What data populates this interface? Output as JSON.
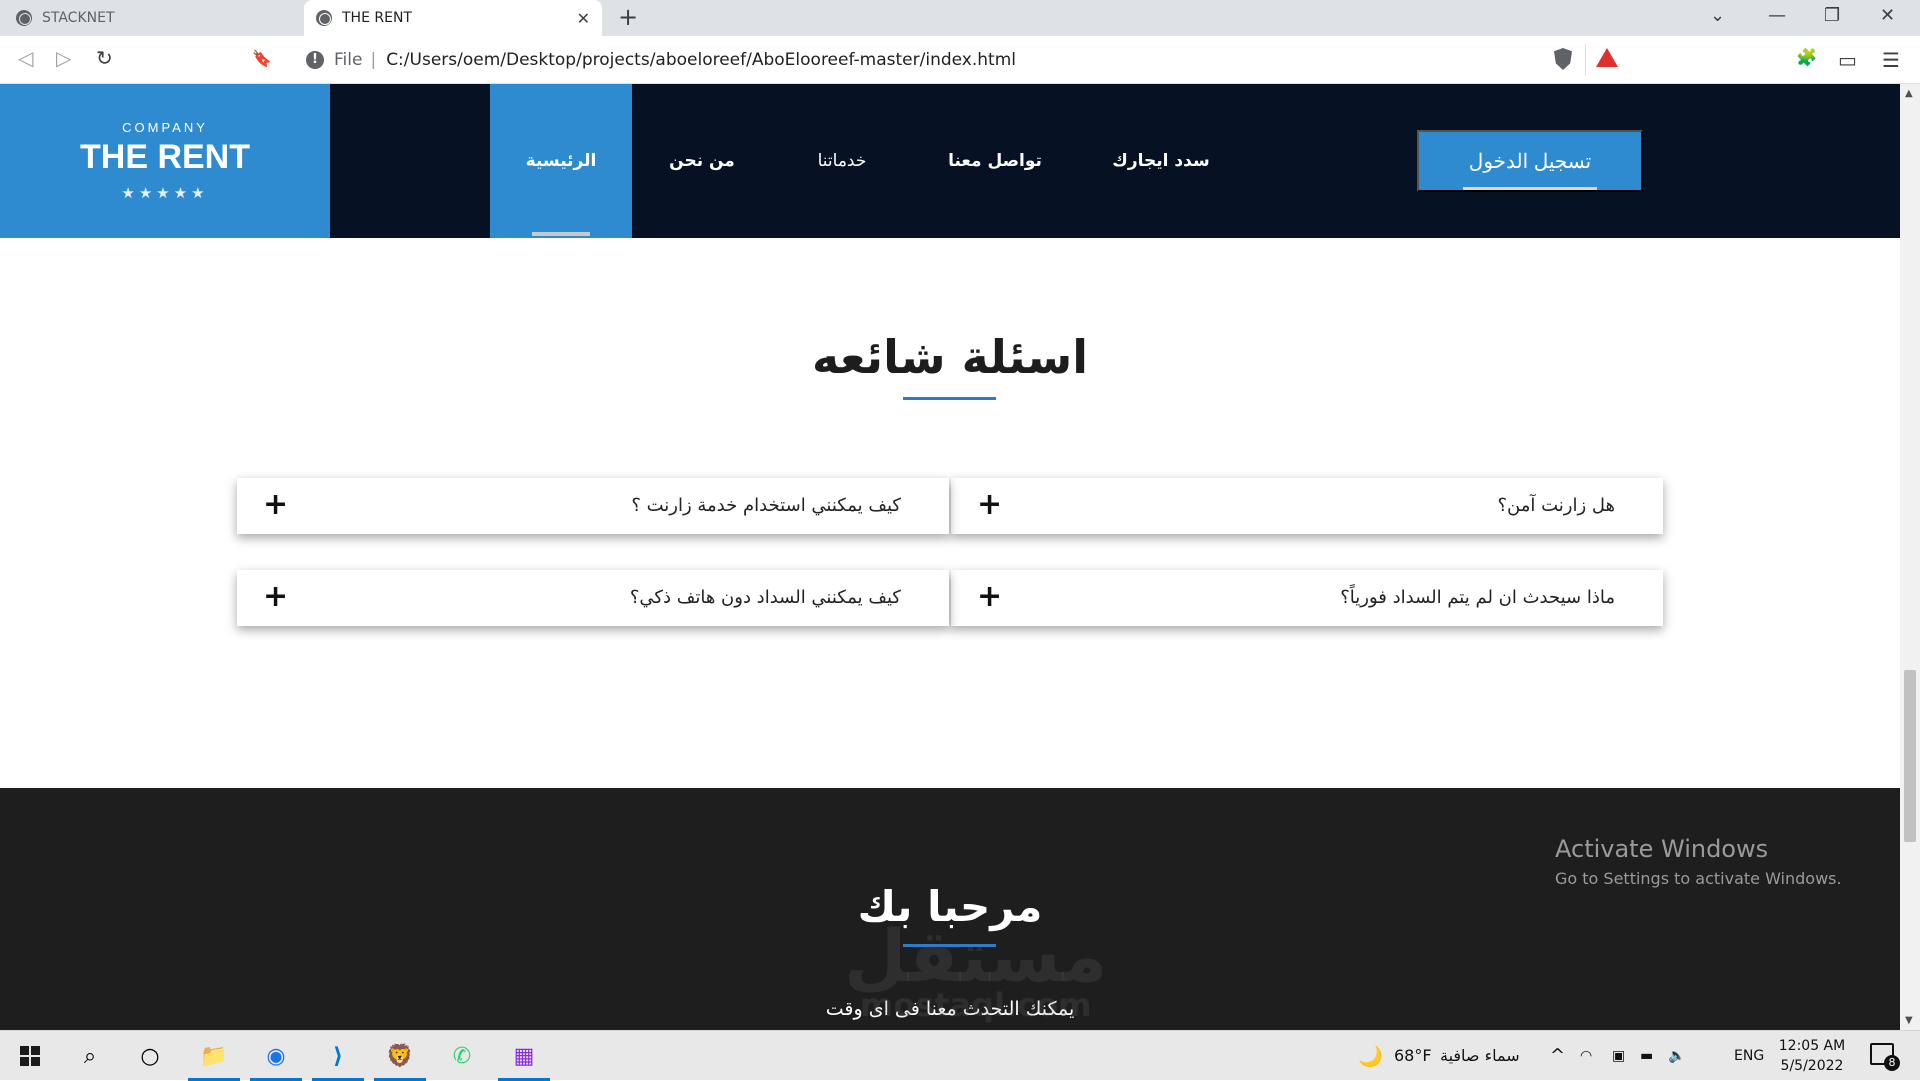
{
  "browser": {
    "tabs": [
      {
        "title": "STACKNET",
        "icon": "globe-icon",
        "active": false
      },
      {
        "title": "THE RENT",
        "icon": "globe-icon",
        "active": true
      }
    ],
    "new_tab": "+",
    "window_controls": {
      "dropdown": "⌄",
      "minimize": "—",
      "restore": "❐",
      "close": "✕"
    },
    "toolbar": {
      "back": "◁",
      "forward": "▷",
      "reload": "↻",
      "bookmark": "🔖"
    },
    "address": {
      "info": "!",
      "scheme_label": "File",
      "separator": "|",
      "url": "C:/Users/oem/Desktop/projects/aboeloreef/AboElooreef-master/index.html"
    },
    "extensions": {
      "puzzle": "🧩",
      "wallet": "▭",
      "menu": "☰"
    }
  },
  "site": {
    "logo": {
      "company": "COMPANY",
      "name": "THE RENT",
      "stars": "★★★★★"
    },
    "nav": [
      {
        "label": "الرئيسية",
        "active": true
      },
      {
        "label": "من نحن",
        "active": false
      },
      {
        "label": "خدماتنا",
        "active": false
      },
      {
        "label": "تواصل معنا",
        "active": false
      },
      {
        "label": "سدد ايجارك",
        "active": false
      }
    ],
    "login_button": "تسجيل الدخول",
    "faq": {
      "title": "اسئلة شائعه",
      "items": [
        {
          "question": "هل زارنت آمن؟",
          "toggle": "+"
        },
        {
          "question": "كيف يمكنني استخدام خدمة زارنت ؟",
          "toggle": "+"
        },
        {
          "question": "ماذا سيحدث ان لم يتم السداد فورياً؟",
          "toggle": "+"
        },
        {
          "question": "كيف يمكنني السداد دون هاتف ذكي؟",
          "toggle": "+"
        }
      ]
    },
    "welcome": {
      "title": "مرحبا بك",
      "subtitle": "يمكنك التحدث معنا فى اى وقت"
    }
  },
  "overlays": {
    "activate_windows": {
      "title": "Activate Windows",
      "subtitle": "Go to Settings to activate Windows."
    },
    "watermark": {
      "arabic": "مستقل",
      "latin": "mostaql.com"
    }
  },
  "scrollbar": {
    "up": "▲",
    "down": "▼",
    "position_fraction": 0.53
  },
  "taskbar": {
    "search": "⌕",
    "task_view": "○",
    "apps": [
      {
        "name": "file-explorer",
        "glyph": "📁",
        "active": true
      },
      {
        "name": "chrome",
        "glyph": "◉",
        "active": true
      },
      {
        "name": "vscode",
        "glyph": "⟩",
        "active": true
      },
      {
        "name": "brave",
        "glyph": "🦁",
        "active": true
      },
      {
        "name": "whatsapp",
        "glyph": "✆",
        "active": false
      },
      {
        "name": "winrar",
        "glyph": "▦",
        "active": true
      }
    ],
    "weather": {
      "icon": "🌙",
      "temp": "68°F",
      "condition": "سماء صافية"
    },
    "tray_chevron": "^",
    "language": "ENG",
    "time": "12:05 AM",
    "date": "5/5/2022",
    "notifications": "8"
  }
}
